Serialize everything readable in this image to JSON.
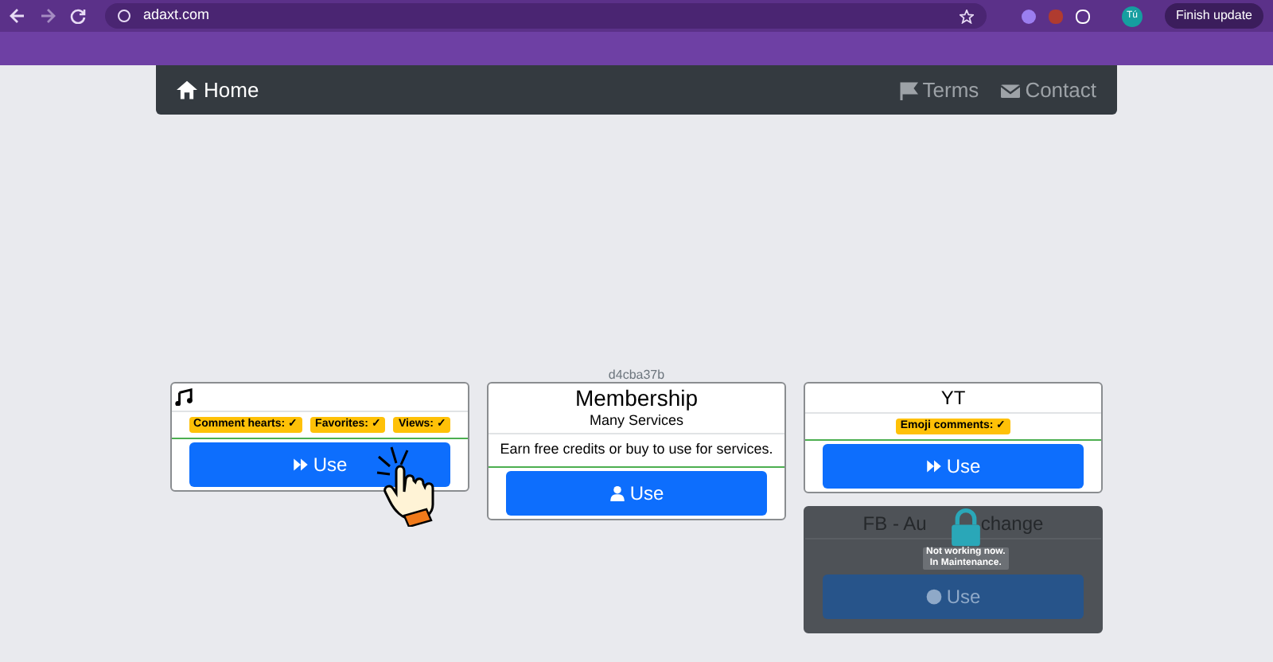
{
  "browser": {
    "url": "adaxt.com",
    "profile": "Tú",
    "update_button": "Finish update"
  },
  "navbar": {
    "brand": "Home",
    "links": [
      {
        "label": "Terms"
      },
      {
        "label": "Contact"
      }
    ]
  },
  "cards": [
    {
      "kind": "music",
      "disabled": false,
      "badges": [
        "Comment hearts: ✓",
        "Favorites: ✓",
        "Views: ✓"
      ],
      "button": {
        "label": "Use"
      },
      "pointer": true
    },
    {
      "kind": "text",
      "disabled": false,
      "caption": "d4cba37b",
      "title": "Membership",
      "subtitle": "Many Services",
      "description": "Earn free credits or buy to use for services.",
      "button": {
        "label": "Use"
      },
      "pointer": false
    },
    {
      "kind": "text",
      "disabled": false,
      "title": "YT",
      "badges": [
        "Emoji comments: ✓"
      ],
      "button": {
        "label": "Use"
      },
      "pointer": false
    },
    {
      "kind": "split",
      "disabled": true,
      "title_parts": [
        "FB - Au",
        "change"
      ],
      "notice": [
        "Not working now.",
        "In Maintenance."
      ],
      "button": {
        "label": "Use"
      },
      "pointer": false
    }
  ]
}
